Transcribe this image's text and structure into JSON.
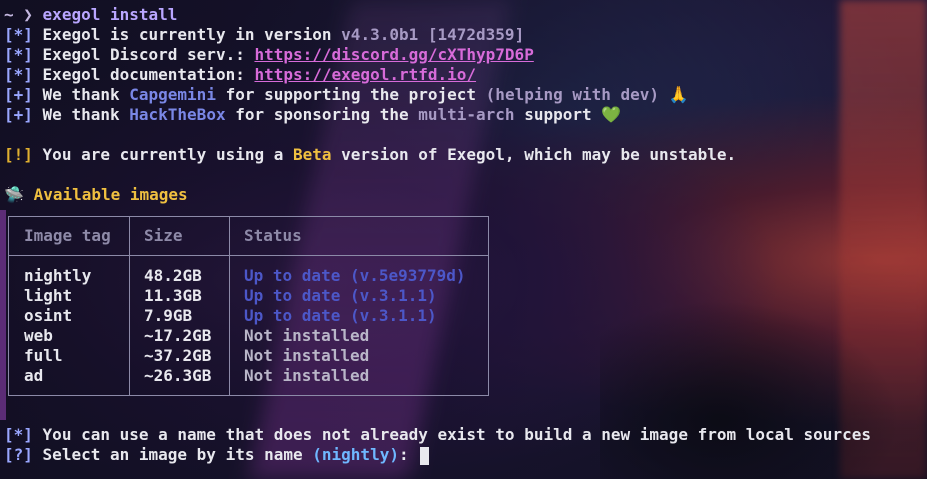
{
  "prompt": {
    "symbol": "~ ❯",
    "command": "exegol install"
  },
  "info_lines": [
    {
      "tag": "[*]",
      "pre": "Exegol is currently in version ",
      "highlight": "v4.3.0b1",
      "post": " [1472d359]"
    },
    {
      "tag": "[*]",
      "pre": "Exegol Discord serv.: ",
      "link": "https://discord.gg/cXThyp7D6P"
    },
    {
      "tag": "[*]",
      "pre": "Exegol documentation: ",
      "link": "https://exegol.rtfd.io/"
    }
  ],
  "thanks_lines": [
    {
      "tag": "[+]",
      "pre": "We thank ",
      "name": "Capgemini",
      "mid": " for supporting the project ",
      "tail": "(helping with dev)",
      "emoji": "🙏"
    },
    {
      "tag": "[+]",
      "pre": "We thank ",
      "name": "HackTheBox",
      "mid": " for sponsoring the ",
      "tail": "multi-arch",
      "end": " support",
      "emoji": "💚"
    }
  ],
  "warning": {
    "tag": "[!]",
    "pre": "You are currently using a ",
    "highlight": "Beta",
    "post": " version of Exegol, which may be unstable."
  },
  "images_title": {
    "icon": "🛸",
    "label": "Available images"
  },
  "table": {
    "headers": [
      "Image tag",
      "Size",
      "Status"
    ],
    "rows": [
      {
        "tag": "nightly",
        "size": "48.2GB",
        "status": "Up to date (v.5e93779d)",
        "installed": true
      },
      {
        "tag": "light",
        "size": "11.3GB",
        "status": "Up to date (v.3.1.1)",
        "installed": true
      },
      {
        "tag": "osint",
        "size": "7.9GB",
        "status": "Up to date (v.3.1.1)",
        "installed": true
      },
      {
        "tag": "web",
        "size": "~17.2GB",
        "status": "Not installed",
        "installed": false
      },
      {
        "tag": "full",
        "size": "~37.2GB",
        "status": "Not installed",
        "installed": false
      },
      {
        "tag": "ad",
        "size": "~26.3GB",
        "status": "Not installed",
        "installed": false
      }
    ]
  },
  "footer": {
    "hint_tag": "[*]",
    "hint": "You can use a name that does not already exist to build a new image from local sources",
    "ask_tag": "[?]",
    "ask_pre": "Select an image by its name ",
    "ask_default": "(nightly)",
    "ask_post": ": "
  },
  "colors": {
    "tag": "#9aa7ff",
    "link": "#d76bd9",
    "warning": "#e0b030",
    "installed_status": "#4c57c8"
  }
}
